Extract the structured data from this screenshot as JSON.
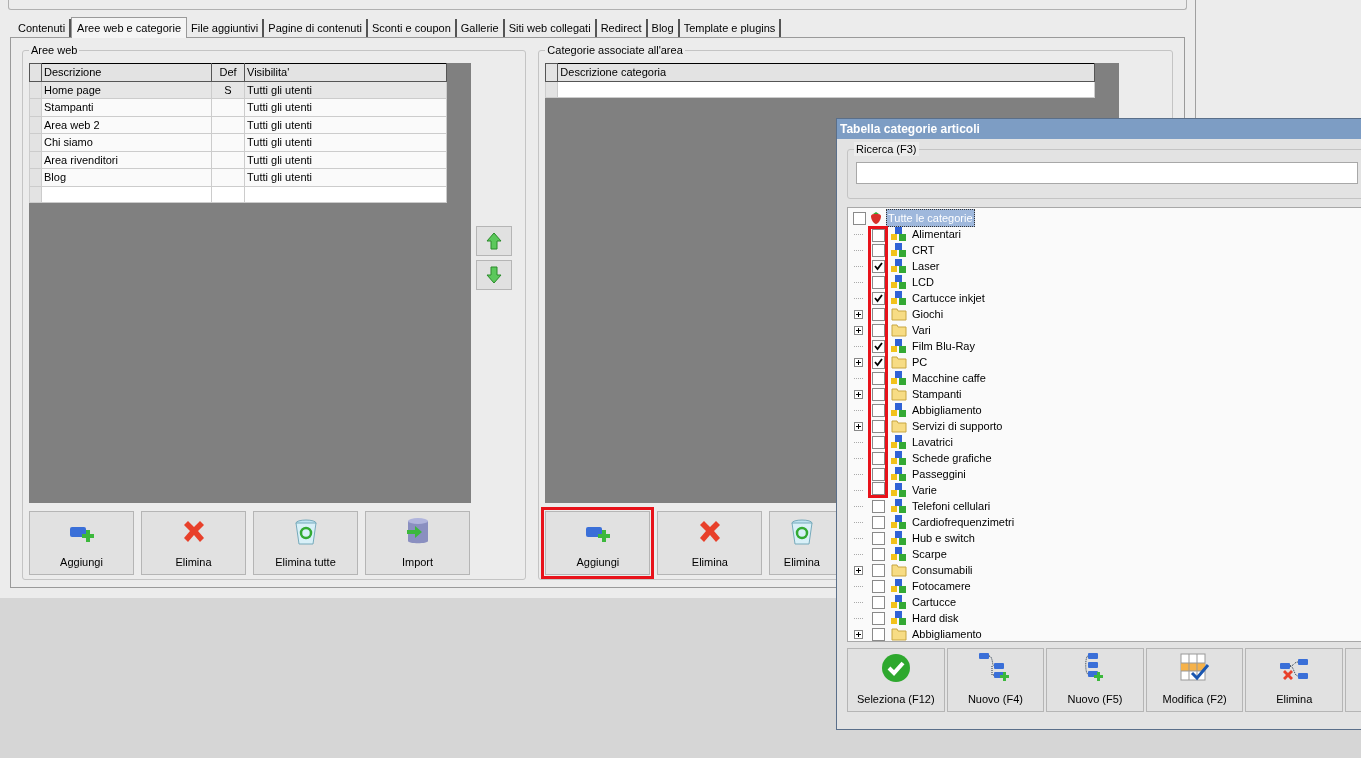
{
  "tabs": [
    {
      "label": "Contenuti",
      "selected": false
    },
    {
      "label": "Aree web e categorie",
      "selected": true
    },
    {
      "label": "File aggiuntivi",
      "selected": false
    },
    {
      "label": "Pagine di contenuti",
      "selected": false
    },
    {
      "label": "Sconti e coupon",
      "selected": false
    },
    {
      "label": "Gallerie",
      "selected": false
    },
    {
      "label": "Siti web collegati",
      "selected": false
    },
    {
      "label": "Redirect",
      "selected": false
    },
    {
      "label": "Blog",
      "selected": false
    },
    {
      "label": "Template e plugins",
      "selected": false
    }
  ],
  "left_panel": {
    "title": "Aree web",
    "table": {
      "columns": [
        "Descrizione",
        "Def",
        "Visibilita'"
      ],
      "rows": [
        {
          "cells": [
            "Home page",
            "S",
            "Tutti gli utenti"
          ],
          "selected": true
        },
        {
          "cells": [
            "Stampanti",
            "",
            "Tutti gli utenti"
          ],
          "selected": false
        },
        {
          "cells": [
            "Area web 2",
            "",
            "Tutti gli utenti"
          ],
          "selected": false
        },
        {
          "cells": [
            "Chi siamo",
            "",
            "Tutti gli utenti"
          ],
          "selected": false
        },
        {
          "cells": [
            "Area rivenditori",
            "",
            "Tutti gli utenti"
          ],
          "selected": false
        },
        {
          "cells": [
            "Blog",
            "",
            "Tutti gli utenti"
          ],
          "selected": false
        }
      ]
    },
    "buttons": [
      {
        "label": "Aggiungi",
        "kind": "add"
      },
      {
        "label": "Elimina",
        "kind": "delete"
      },
      {
        "label": "Elimina tutte",
        "kind": "clear"
      },
      {
        "label": "Import",
        "kind": "import"
      }
    ]
  },
  "right_panel": {
    "title": "Categorie associate all'area",
    "table": {
      "columns": [
        "Descrizione categoria"
      ]
    },
    "buttons": [
      {
        "label": "Aggiungi",
        "kind": "add",
        "highlighted": true
      },
      {
        "label": "Elimina",
        "kind": "delete",
        "highlighted": false
      },
      {
        "label": "Elimina",
        "kind": "clear",
        "highlighted": false
      }
    ]
  },
  "dialog": {
    "title": "Tabella categorie articoli",
    "search": {
      "label": "Ricerca (F3)"
    },
    "tree": {
      "label": "Tutte le categorie",
      "checked": false,
      "selected": true,
      "children": [
        {
          "label": "Alimentari",
          "kind": "item",
          "checked": false,
          "expandable": false,
          "highlighted": true
        },
        {
          "label": "CRT",
          "kind": "item",
          "checked": false,
          "expandable": false,
          "highlighted": true
        },
        {
          "label": "Laser",
          "kind": "item",
          "checked": true,
          "expandable": false,
          "highlighted": true
        },
        {
          "label": "LCD",
          "kind": "item",
          "checked": false,
          "expandable": false,
          "highlighted": true
        },
        {
          "label": "Cartucce inkjet",
          "kind": "item",
          "checked": true,
          "expandable": false,
          "highlighted": true
        },
        {
          "label": "Giochi",
          "kind": "folder",
          "checked": false,
          "expandable": true,
          "highlighted": true
        },
        {
          "label": "Vari",
          "kind": "folder",
          "checked": false,
          "expandable": true,
          "highlighted": true
        },
        {
          "label": "Film Blu-Ray",
          "kind": "item",
          "checked": true,
          "expandable": false,
          "highlighted": true
        },
        {
          "label": "PC",
          "kind": "folder",
          "checked": true,
          "expandable": true,
          "highlighted": true
        },
        {
          "label": "Macchine caffe",
          "kind": "item",
          "checked": false,
          "expandable": false,
          "highlighted": true
        },
        {
          "label": "Stampanti",
          "kind": "folder",
          "checked": false,
          "expandable": true,
          "highlighted": true
        },
        {
          "label": "Abbigliamento",
          "kind": "item",
          "checked": false,
          "expandable": false,
          "highlighted": true
        },
        {
          "label": "Servizi di supporto",
          "kind": "folder",
          "checked": false,
          "expandable": true,
          "highlighted": true
        },
        {
          "label": "Lavatrici",
          "kind": "item",
          "checked": false,
          "expandable": false,
          "highlighted": true
        },
        {
          "label": "Schede grafiche",
          "kind": "item",
          "checked": false,
          "expandable": false,
          "highlighted": true
        },
        {
          "label": "Passeggini",
          "kind": "item",
          "checked": false,
          "expandable": false,
          "highlighted": true
        },
        {
          "label": "Varie",
          "kind": "item",
          "checked": false,
          "expandable": false,
          "highlighted": true
        },
        {
          "label": "Telefoni cellulari",
          "kind": "item",
          "checked": false,
          "expandable": false,
          "highlighted": false
        },
        {
          "label": "Cardiofrequenzimetri",
          "kind": "item",
          "checked": false,
          "expandable": false,
          "highlighted": false
        },
        {
          "label": "Hub e switch",
          "kind": "item",
          "checked": false,
          "expandable": false,
          "highlighted": false
        },
        {
          "label": "Scarpe",
          "kind": "item",
          "checked": false,
          "expandable": false,
          "highlighted": false
        },
        {
          "label": "Consumabili",
          "kind": "folder",
          "checked": false,
          "expandable": true,
          "highlighted": false
        },
        {
          "label": "Fotocamere",
          "kind": "item",
          "checked": false,
          "expandable": false,
          "highlighted": false
        },
        {
          "label": "Cartucce",
          "kind": "item",
          "checked": false,
          "expandable": false,
          "highlighted": false
        },
        {
          "label": "Hard disk",
          "kind": "item",
          "checked": false,
          "expandable": false,
          "highlighted": false
        },
        {
          "label": "Abbigliamento",
          "kind": "folder",
          "checked": false,
          "expandable": true,
          "highlighted": false
        }
      ]
    },
    "buttons": [
      {
        "label": "Seleziona (F12)",
        "kind": "select"
      },
      {
        "label": "Nuovo (F4)",
        "kind": "new-child"
      },
      {
        "label": "Nuovo (F5)",
        "kind": "new-sibling"
      },
      {
        "label": "Modifica (F2)",
        "kind": "edit"
      },
      {
        "label": "Elimina",
        "kind": "delete"
      }
    ]
  }
}
